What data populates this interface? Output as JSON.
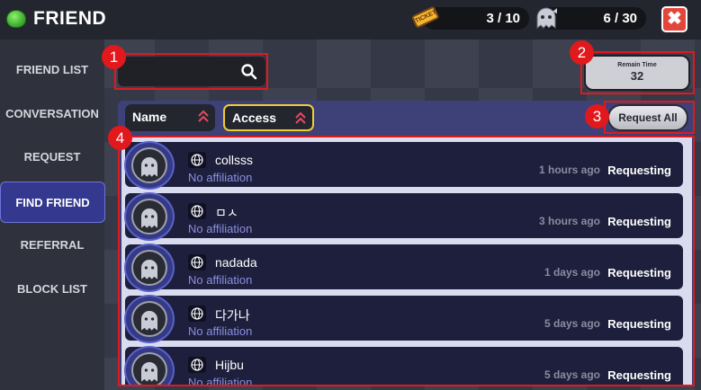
{
  "header": {
    "title": "FRIEND",
    "ticket_counter": "3 / 10",
    "friend_counter": "6 / 30",
    "close_symbol": "✖",
    "ticket_icon_text": "TICKET",
    "icons": [
      "slime-icon",
      "ticket-icon",
      "ghost-icon",
      "close-icon"
    ]
  },
  "sidebar": {
    "items": [
      {
        "label": "FRIEND LIST"
      },
      {
        "label": "CONVERSATION"
      },
      {
        "label": "REQUEST"
      },
      {
        "label": "FIND FRIEND",
        "active": true
      },
      {
        "label": "REFERRAL"
      },
      {
        "label": "BLOCK LIST"
      }
    ]
  },
  "search": {
    "value": "",
    "placeholder": ""
  },
  "remain_time": {
    "label": "Remain Time",
    "value": "32"
  },
  "sort": {
    "name_label": "Name",
    "access_label": "Access",
    "request_all_label": "Request All"
  },
  "rows": [
    {
      "username": "collsss",
      "affiliation": "No affiliation",
      "time_ago": "1 hours ago",
      "status": "Requesting"
    },
    {
      "username": "ㅁㅅ",
      "affiliation": "No affiliation",
      "time_ago": "3 hours ago",
      "status": "Requesting"
    },
    {
      "username": "nadada",
      "affiliation": "No affiliation",
      "time_ago": "1 days ago",
      "status": "Requesting"
    },
    {
      "username": "다가나",
      "affiliation": "No affiliation",
      "time_ago": "5 days ago",
      "status": "Requesting"
    },
    {
      "username": "Hijbu",
      "affiliation": "No affiliation",
      "time_ago": "5 days ago",
      "status": "Requesting"
    }
  ],
  "annotations": [
    "1",
    "2",
    "3",
    "4"
  ],
  "colors": {
    "annotation_red": "#e1191c",
    "access_highlight": "#f2cc2e",
    "active_tab": "#34388f",
    "affiliation_text": "#8a8fe0",
    "sort_arrow": "#e84a5f"
  }
}
